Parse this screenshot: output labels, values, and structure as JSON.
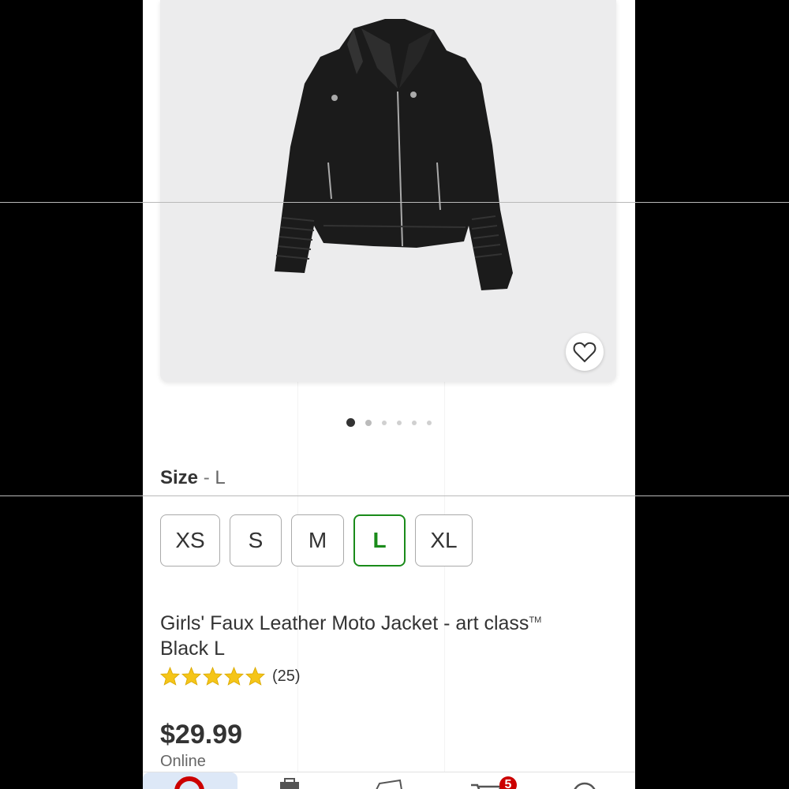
{
  "product_image": {
    "alt": "Girls' Faux Leather Moto Jacket",
    "favorite_icon": "heart-outline-icon",
    "carousel": {
      "total": 6,
      "active_index": 1
    }
  },
  "size_selector": {
    "heading": "Size",
    "separator": " - ",
    "selected_value": "L",
    "options": [
      "XS",
      "S",
      "M",
      "L",
      "XL"
    ]
  },
  "product": {
    "title_line1": "Girls' Faux Leather Moto Jacket - art class",
    "trademark": "TM",
    "title_line2": "Black L",
    "rating": 5,
    "review_count": "(25)",
    "price": "$29.99",
    "availability": "Online"
  },
  "tab_bar": {
    "tabs": [
      {
        "name": "home",
        "icon": "target-bullseye-icon"
      },
      {
        "name": "categories",
        "icon": "bag-icon"
      },
      {
        "name": "deals",
        "icon": "ticket-icon"
      },
      {
        "name": "cart",
        "icon": "cart-icon",
        "badge": "5"
      },
      {
        "name": "account",
        "icon": "account-icon"
      }
    ]
  },
  "colors": {
    "selected_green": "#1a8b1a",
    "star_gold": "#f5c518",
    "badge_red": "#cc0000"
  }
}
